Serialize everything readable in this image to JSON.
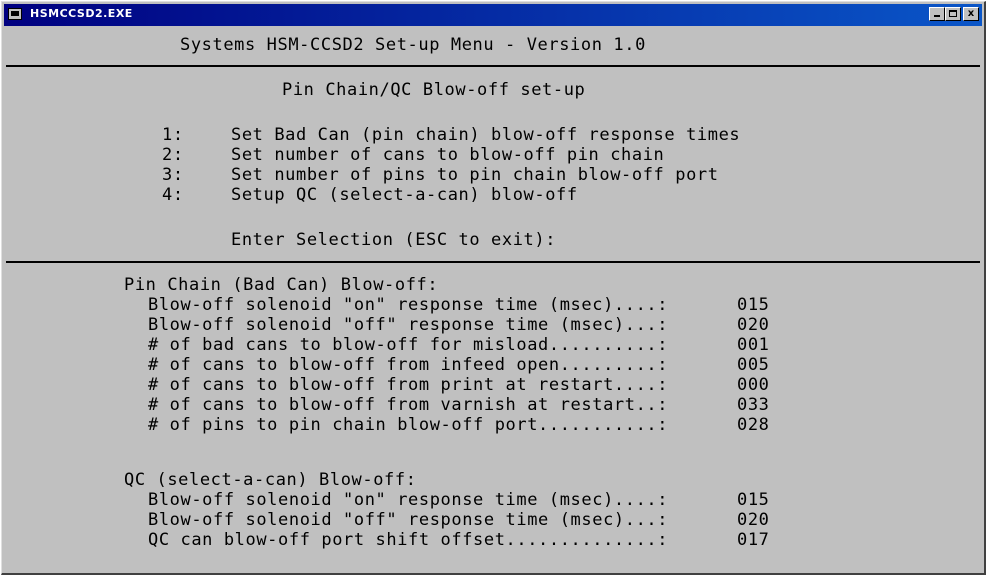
{
  "window": {
    "title": "HSMCCSD2.EXE",
    "controls": {
      "minimize": "_",
      "maximize": "□",
      "close": "x"
    }
  },
  "header": {
    "title": "Systems HSM-CCSD2 Set-up Menu - Version 1.0"
  },
  "menu": {
    "subtitle": "Pin Chain/QC Blow-off set-up",
    "options": [
      {
        "key": "1:",
        "label": "Set Bad Can (pin chain) blow-off response times"
      },
      {
        "key": "2:",
        "label": "Set number of cans to blow-off pin chain"
      },
      {
        "key": "3:",
        "label": "Set number of pins to pin chain blow-off port"
      },
      {
        "key": "4:",
        "label": "Setup QC (select-a-can) blow-off"
      }
    ],
    "prompt": "Enter Selection (ESC to exit):"
  },
  "pin_chain": {
    "heading": "Pin Chain (Bad Can) Blow-off:",
    "rows": [
      {
        "label": "Blow-off solenoid \"on\" response time (msec)....:",
        "value": "015"
      },
      {
        "label": "Blow-off solenoid \"off\" response time (msec)...:",
        "value": "020"
      },
      {
        "label": "# of bad cans to blow-off for misload..........:",
        "value": "001"
      },
      {
        "label": "# of cans to blow-off from infeed open.........:",
        "value": "005"
      },
      {
        "label": "# of cans to blow-off from print at restart....:",
        "value": "000"
      },
      {
        "label": "# of cans to blow-off from varnish at restart..:",
        "value": "033"
      },
      {
        "label": "# of pins to pin chain blow-off port...........:",
        "value": "028"
      }
    ]
  },
  "qc": {
    "heading": "QC (select-a-can) Blow-off:",
    "rows": [
      {
        "label": "Blow-off solenoid \"on\" response time (msec)....:",
        "value": "015"
      },
      {
        "label": "Blow-off solenoid \"off\" response time (msec)...:",
        "value": "020"
      },
      {
        "label": "QC can blow-off port shift offset..............:",
        "value": "017"
      }
    ]
  }
}
